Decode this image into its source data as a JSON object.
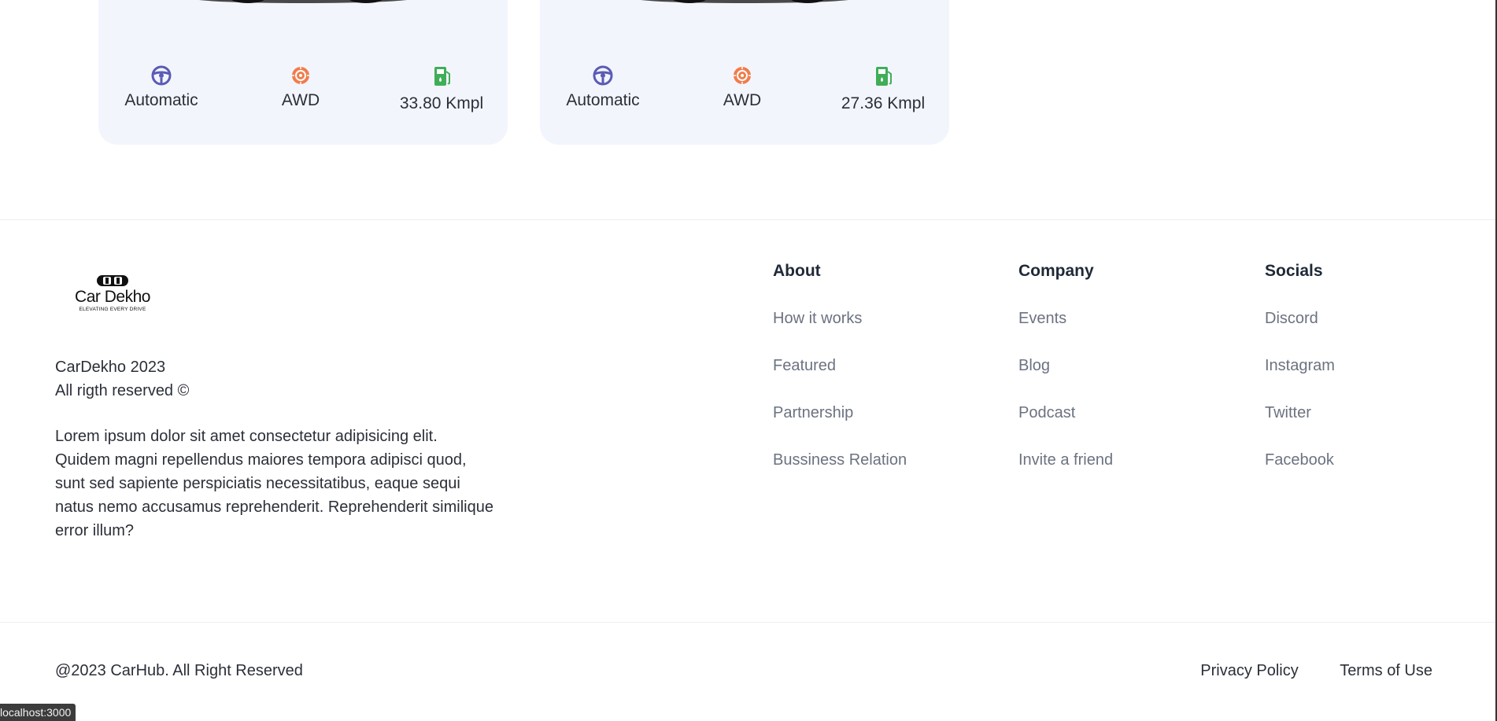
{
  "cards": [
    {
      "specs": [
        {
          "icon": "steering-wheel-icon",
          "label": "Automatic",
          "color": "#5b5bb5"
        },
        {
          "icon": "tire-icon",
          "label": "AWD",
          "color": "#f07d4b"
        },
        {
          "icon": "fuel-pump-icon",
          "label": "33.80 Kmpl",
          "color": "#3fae58"
        }
      ]
    },
    {
      "specs": [
        {
          "icon": "steering-wheel-icon",
          "label": "Automatic",
          "color": "#5b5bb5"
        },
        {
          "icon": "tire-icon",
          "label": "AWD",
          "color": "#f07d4b"
        },
        {
          "icon": "fuel-pump-icon",
          "label": "27.36 Kmpl",
          "color": "#3fae58"
        }
      ]
    }
  ],
  "footer": {
    "logo": {
      "name": "Car Dekho",
      "tagline": "ELEVATING EVERY DRIVE"
    },
    "copyright_line1": "CarDekho 2023",
    "copyright_line2": "All rigth reserved ©",
    "description": "Lorem ipsum dolor sit amet consectetur adipisicing elit. Quidem magni repellendus maiores tempora adipisci quod, sunt sed sapiente perspiciatis necessitatibus, eaque sequi natus nemo accusamus reprehenderit. Reprehenderit similique error illum?",
    "columns": [
      {
        "title": "About",
        "links": [
          "How it works",
          "Featured",
          "Partnership",
          "Bussiness Relation"
        ]
      },
      {
        "title": "Company",
        "links": [
          "Events",
          "Blog",
          "Podcast",
          "Invite a friend"
        ]
      },
      {
        "title": "Socials",
        "links": [
          "Discord",
          "Instagram",
          "Twitter",
          "Facebook"
        ]
      }
    ]
  },
  "bottom_bar": {
    "copyright": "@2023 CarHub. All Right Reserved",
    "privacy": "Privacy Policy",
    "terms": "Terms of Use"
  },
  "status_bar": {
    "url": "localhost:3000"
  },
  "colors": {
    "card_bg": "#f3f5fd",
    "steering": "#5b5bb5",
    "tire": "#f07d4b",
    "fuel": "#3fae58",
    "link_gray": "#6b7280"
  }
}
